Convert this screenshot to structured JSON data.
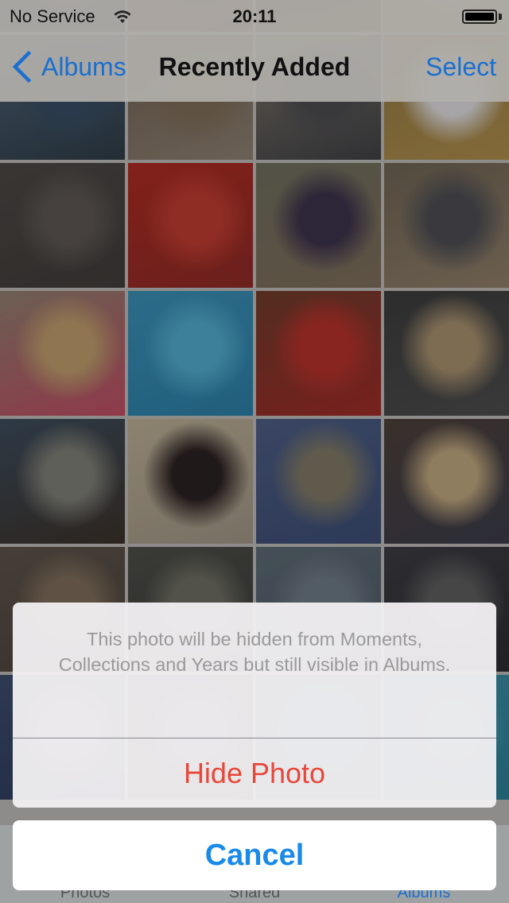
{
  "status_bar": {
    "carrier": "No Service",
    "time": "20:11",
    "wifi_icon": "wifi-icon",
    "battery_icon": "battery-full-icon",
    "battery_level": 1.0
  },
  "nav_bar": {
    "back_label": "Albums",
    "back_icon": "chevron-left-icon",
    "title": "Recently Added",
    "select_label": "Select"
  },
  "photo_grid": {
    "columns": 4,
    "tiles": [
      {
        "desc": "child on beach (partial)",
        "colors": [
          "#3d4550",
          "#8c7a6c",
          "#2d3540"
        ]
      },
      {
        "desc": "child with striped shirt",
        "colors": [
          "#6b5a48",
          "#3a2a2c",
          "#7a3030"
        ]
      },
      {
        "desc": "sunset over ocean",
        "colors": [
          "#2e2e2c",
          "#4a4438",
          "#6a4a20"
        ]
      },
      {
        "desc": "phone screen",
        "colors": [
          "#a9a8ab",
          "#c8c6c8",
          "#a7894a"
        ]
      },
      {
        "desc": "child by the sea",
        "colors": [
          "#4d6278",
          "#364a60",
          "#2d3a44"
        ]
      },
      {
        "desc": "broken wall interior",
        "colors": [
          "#6a5c4c",
          "#7a6a56",
          "#8a7c6e"
        ]
      },
      {
        "desc": "woman and child in street",
        "colors": [
          "#7a7468",
          "#4a4a4e",
          "#3e3e42"
        ]
      },
      {
        "desc": "iPhone showing email",
        "colors": [
          "#8c7440",
          "#d6d4d6",
          "#a8884a"
        ]
      },
      {
        "desc": "paint swatches",
        "colors": [
          "#4a4542",
          "#5a5450",
          "#3e3a38"
        ]
      },
      {
        "desc": "child in red toy car",
        "colors": [
          "#a82a22",
          "#b83a30",
          "#8a2a24"
        ]
      },
      {
        "desc": "woman in chair with child",
        "colors": [
          "#6a6a5a",
          "#3a3048",
          "#7a6a58"
        ]
      },
      {
        "desc": "child in car seat",
        "colors": [
          "#6a6050",
          "#4a4a50",
          "#8a7a66"
        ]
      },
      {
        "desc": "blonde child in pink",
        "colors": [
          "#8a7a6a",
          "#b89868",
          "#b84a60"
        ]
      },
      {
        "desc": "child in pool",
        "colors": [
          "#3a8ab0",
          "#4ea4c4",
          "#2a7aa0"
        ]
      },
      {
        "desc": "child in red toy car",
        "colors": [
          "#6a3a2a",
          "#b0302a",
          "#9a2a26"
        ]
      },
      {
        "desc": "laughing child",
        "colors": [
          "#3a3a3a",
          "#a08a6a",
          "#4a4a4a"
        ]
      },
      {
        "desc": "sunset hills",
        "colors": [
          "#3a4a5a",
          "#7a7a72",
          "#3a3028"
        ]
      },
      {
        "desc": "mochi ice cream boxes",
        "colors": [
          "#b4a890",
          "#2a2020",
          "#9a9080"
        ]
      },
      {
        "desc": "glitter water surface",
        "colors": [
          "#4a5a80",
          "#7a7462",
          "#3a4a70"
        ]
      },
      {
        "desc": "curly haired child",
        "colors": [
          "#4a3e38",
          "#b8a07a",
          "#3a3a48"
        ]
      },
      {
        "desc": "tile row 6 col 1",
        "colors": [
          "#5a5048",
          "#7a6a58",
          "#4a4038"
        ]
      },
      {
        "desc": "tile row 6 col 2",
        "colors": [
          "#4a4a46",
          "#6a6a60",
          "#3a3a36"
        ]
      },
      {
        "desc": "tile row 6 col 3",
        "colors": [
          "#5a6670",
          "#6a7680",
          "#4a5660"
        ]
      },
      {
        "desc": "child in car seat",
        "colors": [
          "#3a3a40",
          "#5a5a5a",
          "#2a2a30"
        ]
      },
      {
        "desc": "clouds",
        "colors": [
          "#3a4a68",
          "#8a8a84",
          "#2a3a58"
        ]
      },
      {
        "desc": "trees and railing",
        "colors": [
          "#2a3020",
          "#6a6a66",
          "#1e2418"
        ]
      },
      {
        "desc": "pool",
        "colors": [
          "#2a7890",
          "#3a8aa0",
          "#2a6a80"
        ]
      },
      {
        "desc": "pool",
        "colors": [
          "#3a8aa0",
          "#4a9ab0",
          "#2a7a90"
        ]
      }
    ]
  },
  "action_sheet": {
    "message": "This photo will be hidden from Moments, Collections and Years but still visible in Albums.",
    "destructive_label": "Hide Photo",
    "cancel_label": "Cancel"
  },
  "tab_bar": {
    "tabs": [
      {
        "label": "Photos",
        "active": false
      },
      {
        "label": "Shared",
        "active": false
      },
      {
        "label": "Albums",
        "active": true
      }
    ]
  },
  "colors": {
    "tint": "#1a6fd0",
    "cancel_blue": "#1a8ae8",
    "destructive": "#e8483a",
    "message_gray": "#9a9a9a"
  }
}
